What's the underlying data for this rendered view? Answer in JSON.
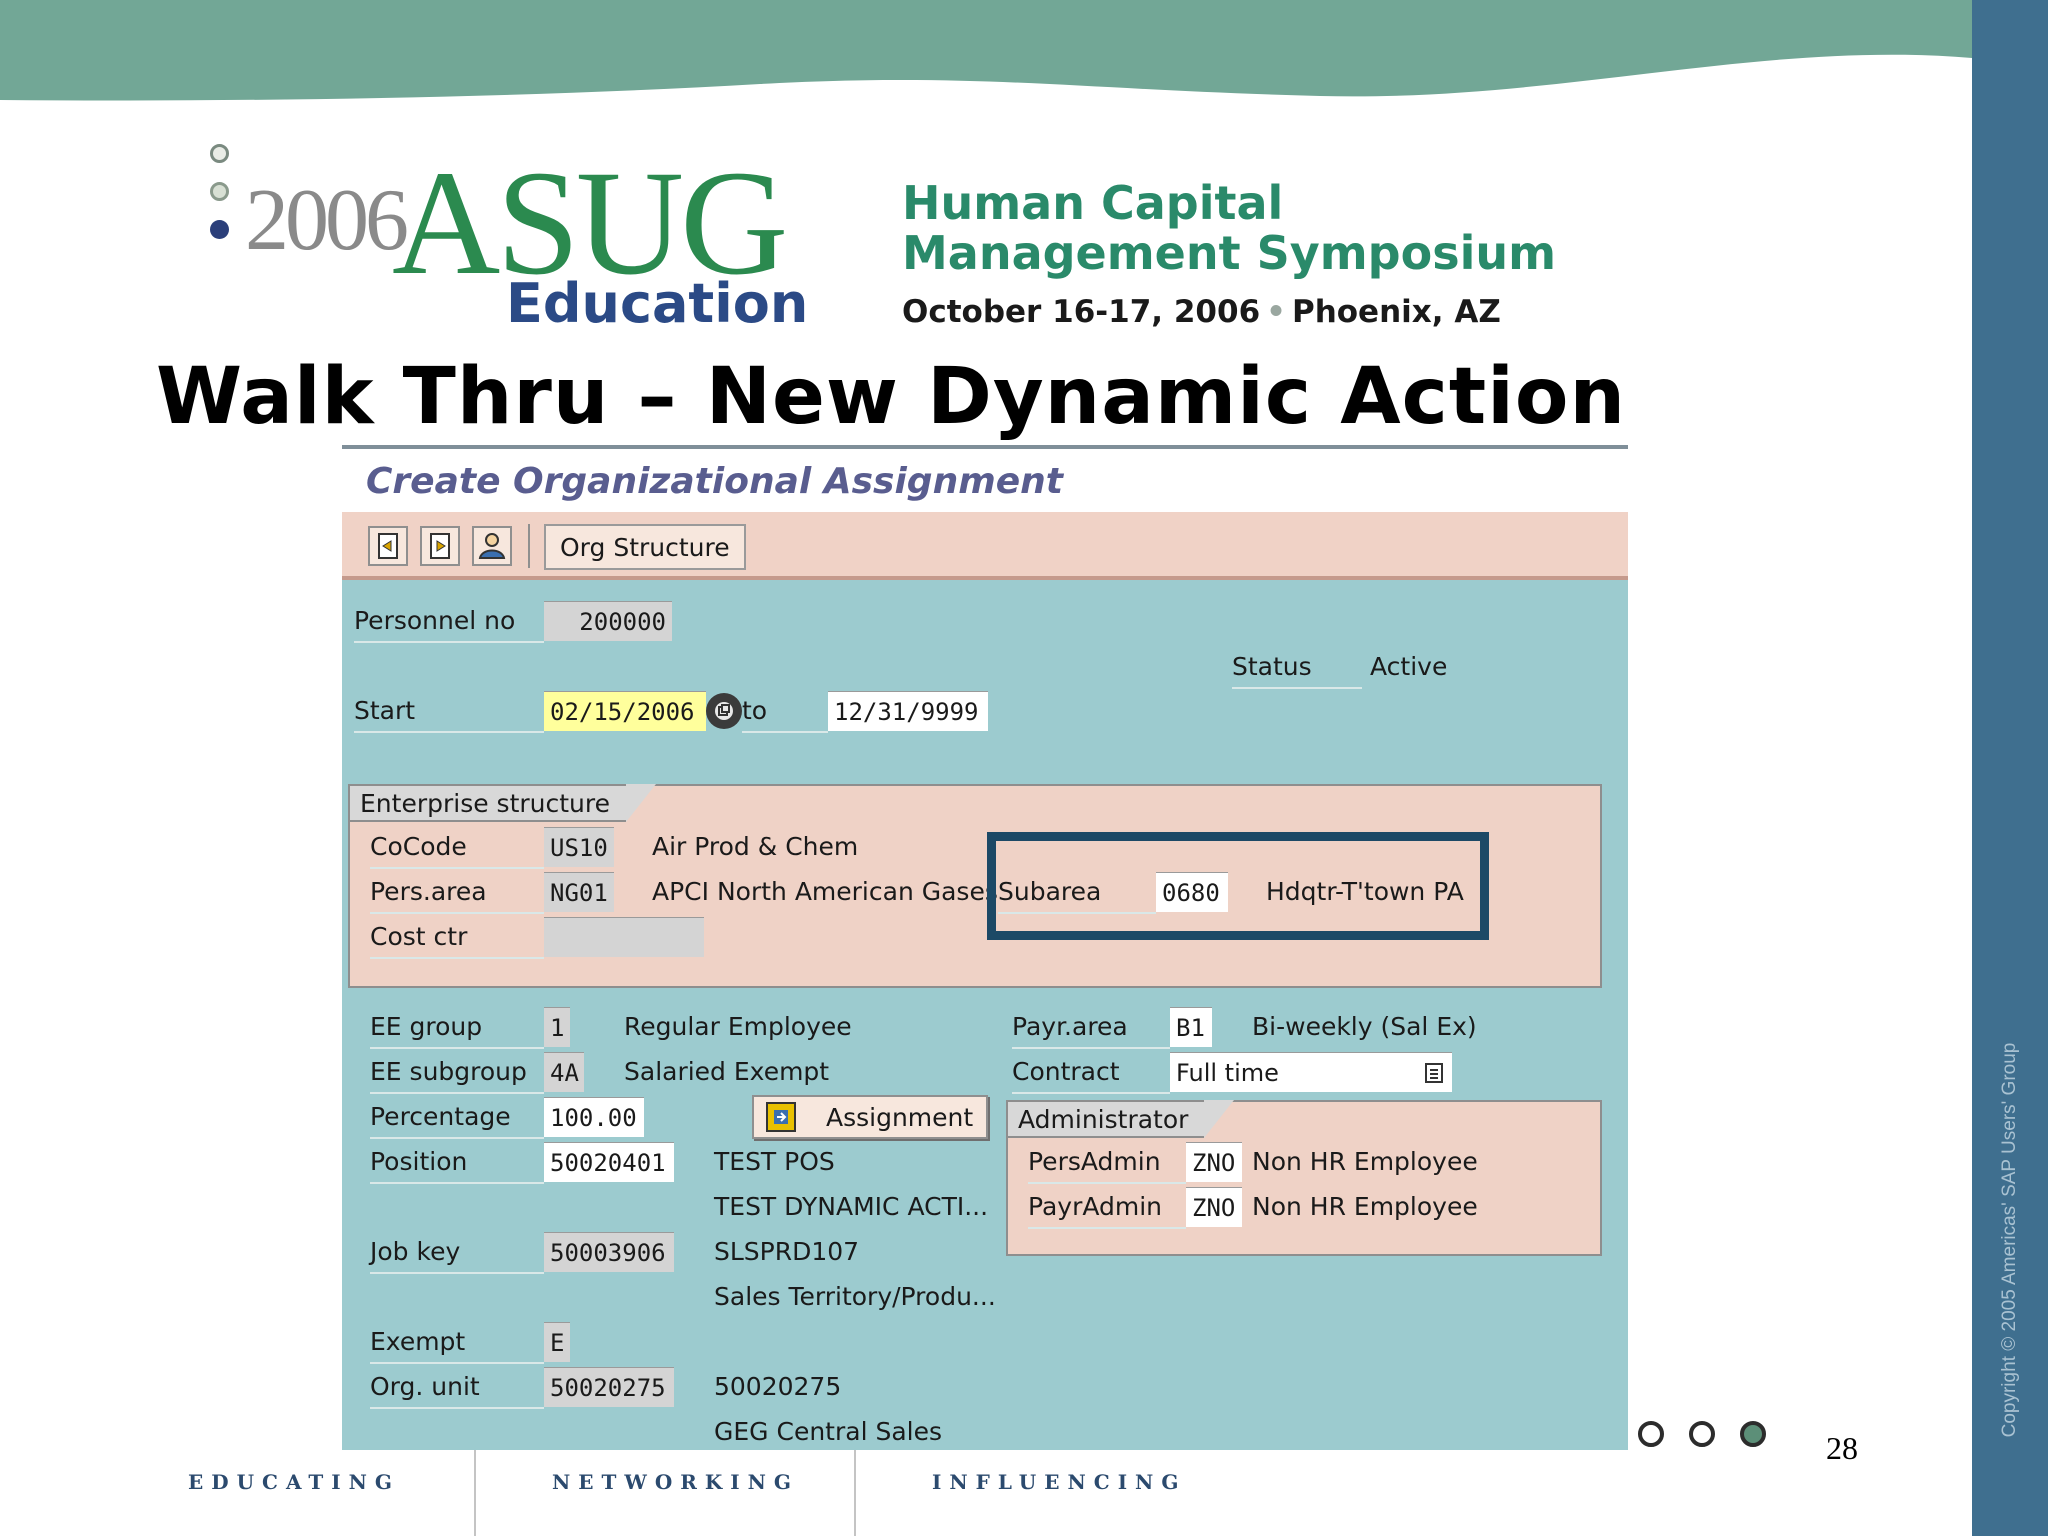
{
  "header": {
    "logo_year": "2006",
    "logo_name": "ASUG",
    "logo_sub": "Education",
    "symposium_line1": "Human Capital",
    "symposium_line2": "Management Symposium",
    "event_date": "October 16-17, 2006",
    "event_location": "Phoenix, AZ"
  },
  "slide": {
    "title": "Walk Thru – New Dynamic Action",
    "page_number": "28",
    "copyright": "Copyright © 2005 Americas' SAP Users' Group"
  },
  "sap": {
    "screen_title": "Create Organizational Assignment",
    "toolbar": {
      "icons": [
        "previous-record-icon",
        "next-record-icon",
        "person-overview-icon"
      ],
      "org_structure_label": "Org Structure"
    },
    "personnel_no_label": "Personnel no",
    "personnel_no": "200000",
    "status_label": "Status",
    "status_value": "Active",
    "start_label": "Start",
    "start_date": "02/15/2006",
    "to_label": "to",
    "end_date": "12/31/9999",
    "enterprise": {
      "group_title": "Enterprise structure",
      "cocode_label": "CoCode",
      "cocode_value": "US10",
      "cocode_text": "Air Prod & Chem",
      "persarea_label": "Pers.area",
      "persarea_value": "NG01",
      "persarea_text": "APCI North American Gases",
      "subarea_label": "Subarea",
      "subarea_value": "0680",
      "subarea_text": "Hdqtr-T'town PA",
      "costctr_label": "Cost ctr",
      "costctr_value": ""
    },
    "assignment": {
      "eegroup_label": "EE group",
      "eegroup_value": "1",
      "eegroup_text": "Regular Employee",
      "eesubgroup_label": "EE subgroup",
      "eesubgroup_value": "4A",
      "eesubgroup_text": "Salaried Exempt",
      "percentage_label": "Percentage",
      "percentage_value": "100.00",
      "assignment_button": "Assignment",
      "position_label": "Position",
      "position_value": "50020401",
      "position_text1": "TEST POS",
      "position_text2": "TEST DYNAMIC ACTI...",
      "jobkey_label": "Job key",
      "jobkey_value": "50003906",
      "jobkey_text1": "SLSPRD107",
      "jobkey_text2": "Sales Territory/Produ...",
      "exempt_label": "Exempt",
      "exempt_value": "E",
      "orgunit_label": "Org. unit",
      "orgunit_value": "50020275",
      "orgunit_text1": "50020275",
      "orgunit_text2": "GEG Central Sales"
    },
    "payroll": {
      "payrarea_label": "Payr.area",
      "payrarea_value": "B1",
      "payrarea_text": "Bi-weekly (Sal Ex)",
      "contract_label": "Contract",
      "contract_value": "Full time"
    },
    "administrator": {
      "group_title": "Administrator",
      "persadmin_label": "PersAdmin",
      "persadmin_value": "ZNO",
      "persadmin_text": "Non HR Employee",
      "payradmin_label": "PayrAdmin",
      "payradmin_value": "ZNO",
      "payradmin_text": "Non HR Employee"
    }
  },
  "footer": {
    "words": [
      "EDUCATING",
      "NETWORKING",
      "INFLUENCING"
    ]
  },
  "colors": {
    "band_green": "#72a796",
    "sap_teal": "#9ccbcf",
    "sap_salmon": "#f0d2c6",
    "highlight_navy": "#1c4966",
    "right_bar_blue": "#3f6f8f"
  }
}
